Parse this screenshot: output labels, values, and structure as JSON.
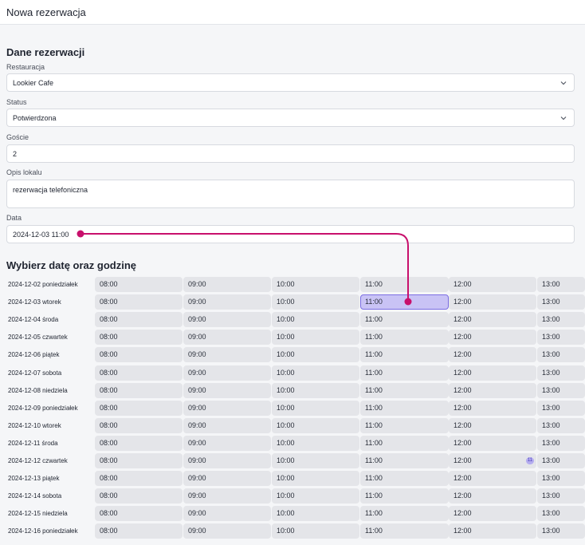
{
  "header": {
    "title": "Nowa rezerwacja"
  },
  "form": {
    "section_title": "Dane rezerwacji",
    "restaurant": {
      "label": "Restauracja",
      "value": "Lookier Cafe"
    },
    "status": {
      "label": "Status",
      "value": "Potwierdzona"
    },
    "guests": {
      "label": "Goście",
      "value": "2"
    },
    "description": {
      "label": "Opis lokalu",
      "value": "rezerwacja telefoniczna"
    },
    "date": {
      "label": "Data",
      "value": "2024-12-03 11:00"
    }
  },
  "schedule": {
    "title": "Wybierz datę oraz godzinę",
    "times": [
      "08:00",
      "09:00",
      "10:00",
      "11:00",
      "12:00",
      "13:00"
    ],
    "days": [
      "2024-12-02 poniedziałek",
      "2024-12-03 wtorek",
      "2024-12-04 środa",
      "2024-12-05 czwartek",
      "2024-12-06 piątek",
      "2024-12-07 sobota",
      "2024-12-08 niedziela",
      "2024-12-09 poniedziałek",
      "2024-12-10 wtorek",
      "2024-12-11 środa",
      "2024-12-12 czwartek",
      "2024-12-13 piątek",
      "2024-12-14 sobota",
      "2024-12-15 niedziela",
      "2024-12-16 poniedziałek"
    ],
    "selected": {
      "day": "2024-12-03 wtorek",
      "time": "11:00"
    },
    "badge": {
      "day": "2024-12-12 czwartek",
      "time": "12:00",
      "text": "11"
    }
  },
  "colors": {
    "accent": "#c8106c",
    "selected_fill": "#c9c3f5",
    "selected_border": "#7c6fe3",
    "slot_fill": "#e4e5e9"
  },
  "icons": {
    "select_chevron": "chevron-down-icon"
  }
}
